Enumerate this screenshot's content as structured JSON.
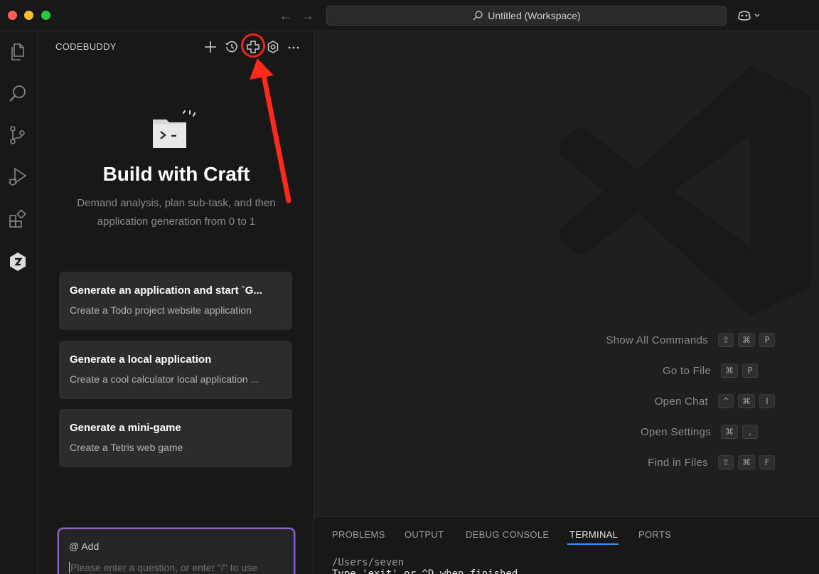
{
  "window": {
    "title": "Untitled (Workspace)"
  },
  "sidebar": {
    "title": "CODEBUDDY",
    "hero": {
      "title": "Build with Craft",
      "subtitle_line1": "Demand analysis, plan sub-task, and then",
      "subtitle_line2": "application generation from 0 to 1"
    },
    "cards": [
      {
        "title": "Generate an application and start `G...",
        "description": "Create a Todo project website application"
      },
      {
        "title": "Generate a local application",
        "description": "Create a cool calculator local application ..."
      },
      {
        "title": "Generate a mini-game",
        "description": "Create a Tetris web game"
      }
    ],
    "chat": {
      "add_label": "@ Add",
      "placeholder": "Please enter a question, or enter \"/\" to use"
    }
  },
  "editor": {
    "shortcuts": [
      {
        "label": "Show All Commands",
        "keys": [
          "⇧",
          "⌘",
          "P"
        ]
      },
      {
        "label": "Go to File",
        "keys": [
          "⌘",
          "P"
        ]
      },
      {
        "label": "Open Chat",
        "keys": [
          "^",
          "⌘",
          "I"
        ]
      },
      {
        "label": "Open Settings",
        "keys": [
          "⌘",
          ","
        ]
      },
      {
        "label": "Find in Files",
        "keys": [
          "⇧",
          "⌘",
          "F"
        ]
      }
    ]
  },
  "panel": {
    "tabs": [
      "PROBLEMS",
      "OUTPUT",
      "DEBUG CONSOLE",
      "TERMINAL",
      "PORTS"
    ],
    "active_tab": "TERMINAL",
    "terminal_lines": [
      "/Users/seven",
      "Type 'exit' or ^D when finished"
    ]
  },
  "colors": {
    "highlight": "#e8271b",
    "accent": "#3794ff",
    "chat_border": "#8a62c9"
  }
}
